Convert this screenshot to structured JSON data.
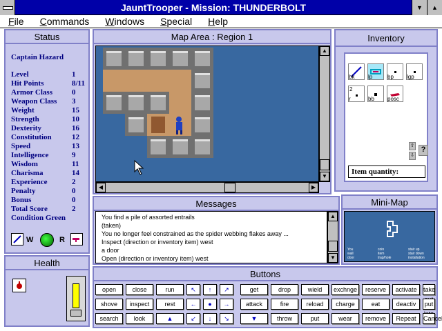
{
  "window": {
    "title": "JauntTrooper - Mission: THUNDERBOLT"
  },
  "menu": [
    "File",
    "Commands",
    "Windows",
    "Special",
    "Help"
  ],
  "status": {
    "title": "Status",
    "name": "Captain Hazard",
    "stats": [
      {
        "label": "Level",
        "value": "1"
      },
      {
        "label": "Hit Points",
        "value": "8/11"
      },
      {
        "label": "Armor Class",
        "value": "0"
      },
      {
        "label": "Weapon Class",
        "value": "3"
      },
      {
        "label": "Weight",
        "value": "15"
      },
      {
        "label": "Strength",
        "value": "10"
      },
      {
        "label": "Dexterity",
        "value": "16"
      },
      {
        "label": "Constitution",
        "value": "12"
      },
      {
        "label": "Speed",
        "value": "13"
      },
      {
        "label": "Intelligence",
        "value": "9"
      },
      {
        "label": "Wisdom",
        "value": "11"
      },
      {
        "label": "Charisma",
        "value": "14"
      },
      {
        "label": "Experience",
        "value": "2"
      },
      {
        "label": "Penalty",
        "value": "0"
      },
      {
        "label": "Bonus",
        "value": "0"
      },
      {
        "label": "Total Score",
        "value": "2"
      }
    ],
    "condition": "Condition Green",
    "wield_label": "W",
    "ready_label": "R"
  },
  "health": {
    "title": "Health"
  },
  "map": {
    "title": "Map Area : Region 1"
  },
  "messages": {
    "title": "Messages",
    "lines": [
      "You find a pile of assorted entrails",
      "(taken)",
      "You no longer feel constrained as the spider webbing flakes away ...",
      "Inspect (direction or inventory item) west",
      "a door",
      "Open (direction or inventory item) west"
    ]
  },
  "inventory": {
    "title": "Inventory",
    "items": [
      {
        "label": "bk"
      },
      {
        "label": "lp"
      },
      {
        "label": "bp"
      },
      {
        "label": "lgp"
      },
      {
        "label": "r",
        "count": "2"
      },
      {
        "label": "bb"
      },
      {
        "label": "posc"
      }
    ],
    "quantity_label": "Item quantity:",
    "help_label": "?"
  },
  "minimap": {
    "title": "Mini-Map",
    "legend": [
      [
        "You",
        "coin",
        "stair up"
      ],
      [
        "wall",
        "item",
        "stair down"
      ],
      [
        "door",
        "trap/hole",
        "installation"
      ]
    ]
  },
  "buttons": {
    "title": "Buttons",
    "left": [
      [
        "open",
        "close",
        "run"
      ],
      [
        "shove",
        "inspect",
        "rest"
      ],
      [
        "search",
        "look",
        ""
      ]
    ],
    "right": [
      [
        "get",
        "drop",
        "wield",
        "exchnge",
        "reserve",
        "activate",
        "take out"
      ],
      [
        "attack",
        "fire",
        "reload",
        "charge",
        "eat",
        "deactiv",
        "put into"
      ],
      [
        "",
        "throw",
        "put",
        "wear",
        "remove",
        "Repeat",
        "Cancel"
      ]
    ]
  },
  "colors": {
    "panel": "#c8c8ec",
    "border": "#8080c8",
    "title": "#0000a8",
    "water": "#3868a0",
    "floor": "#c89868"
  }
}
